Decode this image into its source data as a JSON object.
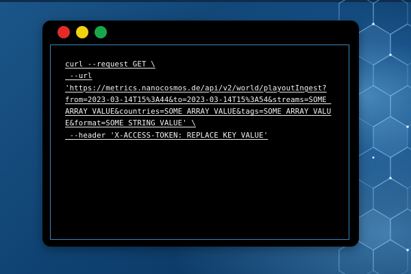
{
  "window": {
    "controls": {
      "close_color": "#e52a2a",
      "minimize_color": "#f1d20f",
      "maximize_color": "#19a64a"
    }
  },
  "terminal": {
    "lines": [
      "curl --request GET \\",
      " --url",
      "'https://metrics.nanocosmos.de/api/v2/world/playoutIngest?",
      "from=2023-03-14T15%3A44&to=2023-03-14T15%3A54&streams=SOME_",
      "ARRAY_VALUE&countries=SOME_ARRAY_VALUE&tags=SOME_ARRAY_VALU",
      "E&format=SOME_STRING_VALUE' \\",
      " --header 'X-ACCESS-TOKEN: REPLACE_KEY_VALUE'"
    ],
    "border_color": "#3b86c2"
  },
  "background": {
    "base_color": "#134a78",
    "accent_color": "#7fc8ff"
  }
}
